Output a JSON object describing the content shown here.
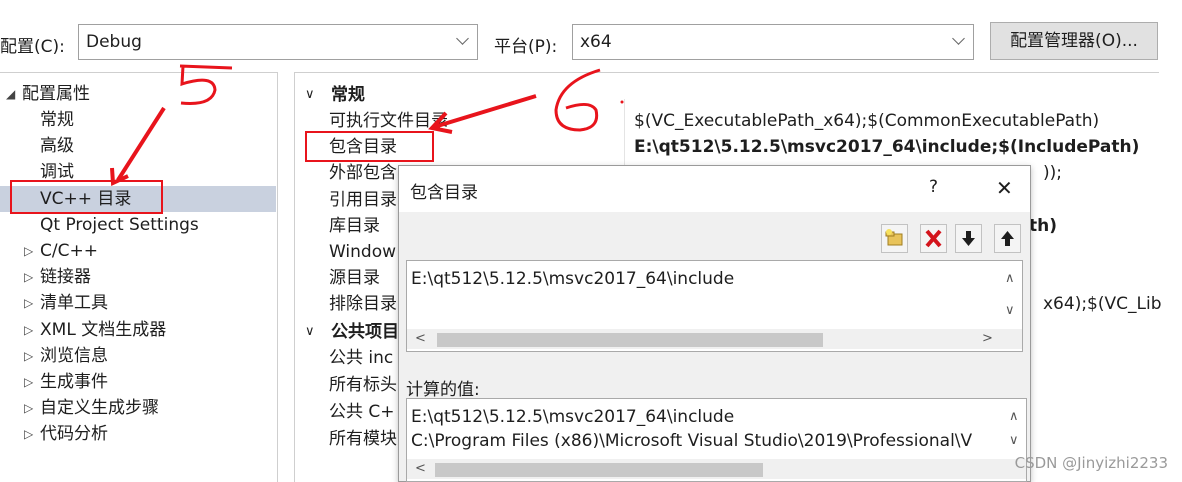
{
  "config_bar": {
    "config_label": "配置(C):",
    "config_value": "Debug",
    "platform_label": "平台(P):",
    "platform_value": "x64",
    "manager_button": "配置管理器(O)..."
  },
  "tree": {
    "root": "配置属性",
    "items": [
      {
        "label": "常规",
        "expandable": false
      },
      {
        "label": "高级",
        "expandable": false
      },
      {
        "label": "调试",
        "expandable": false
      },
      {
        "label": "VC++ 目录",
        "expandable": false,
        "selected": true
      },
      {
        "label": "Qt Project Settings",
        "expandable": false
      },
      {
        "label": "C/C++",
        "expandable": true
      },
      {
        "label": "链接器",
        "expandable": true
      },
      {
        "label": "清单工具",
        "expandable": true
      },
      {
        "label": "XML 文档生成器",
        "expandable": true
      },
      {
        "label": "浏览信息",
        "expandable": true
      },
      {
        "label": "生成事件",
        "expandable": true
      },
      {
        "label": "自定义生成步骤",
        "expandable": true
      },
      {
        "label": "代码分析",
        "expandable": true
      }
    ]
  },
  "grid": {
    "category_general": "常规",
    "category_public": "公共项目",
    "rows": [
      {
        "name": "可执行文件目录",
        "value": "$(VC_ExecutablePath_x64);$(CommonExecutablePath)"
      },
      {
        "name": "包含目录",
        "value": "E:\\qt512\\5.12.5\\msvc2017_64\\include;$(IncludePath)"
      },
      {
        "name": "外部包含",
        "value": "));"
      },
      {
        "name": "引用目录",
        "value": ""
      },
      {
        "name": "库目录",
        "value": "th)"
      },
      {
        "name": "Window",
        "value": ""
      },
      {
        "name": "源目录",
        "value": ""
      },
      {
        "name": "排除目录",
        "value": "x64);$(VC_Lib"
      }
    ],
    "public_rows": [
      "公共 inc",
      "所有标头",
      "公共 C+",
      "所有模块"
    ]
  },
  "dialog": {
    "title": "包含目录",
    "help": "?",
    "close": "✕",
    "edit_text": "E:\\qt512\\5.12.5\\msvc2017_64\\include",
    "computed_label": "计算的值:",
    "computed_lines": [
      "E:\\qt512\\5.12.5\\msvc2017_64\\include",
      "C:\\Program Files (x86)\\Microsoft Visual Studio\\2019\\Professional\\V"
    ]
  },
  "annotations": {
    "five": "5",
    "six": "6"
  },
  "watermark": "CSDN @Jinyizhi2233",
  "colors": {
    "annotation_red": "#e8141c",
    "selected_row": "#c9d1df",
    "category_bg": "#ffffff"
  }
}
